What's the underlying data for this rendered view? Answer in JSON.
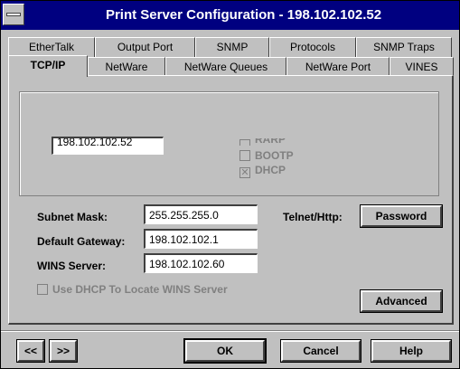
{
  "window": {
    "title": "Print Server Configuration - 198.102.102.52"
  },
  "tabs_back": [
    {
      "label": "EtherTalk"
    },
    {
      "label": "Output Port"
    },
    {
      "label": "SNMP"
    },
    {
      "label": "Protocols"
    },
    {
      "label": "SNMP Traps"
    }
  ],
  "tabs_front": [
    {
      "label": "TCP/IP",
      "active": true
    },
    {
      "label": "NetWare"
    },
    {
      "label": "NetWare Queues"
    },
    {
      "label": "NetWare Port"
    },
    {
      "label": "VINES"
    }
  ],
  "ip_field": {
    "value": "198.102.102.52"
  },
  "protocol_options": {
    "rarp_label": "RARP",
    "bootp_label": "BOOTP",
    "dhcp_label": "DHCP",
    "dhcp_checked": true
  },
  "subnet": {
    "label": "Subnet Mask:",
    "value": "255.255.255.0"
  },
  "gateway": {
    "label": "Default Gateway:",
    "value": "198.102.102.1"
  },
  "wins": {
    "label": "WINS Server:",
    "value": "198.102.102.60"
  },
  "use_dhcp_wins": {
    "label": "Use DHCP To Locate WINS Server"
  },
  "telnet": {
    "label": "Telnet/Http:"
  },
  "buttons": {
    "password": "Password",
    "advanced": "Advanced",
    "prev": "<<",
    "next": ">>",
    "ok": "OK",
    "cancel": "Cancel",
    "help": "Help"
  }
}
